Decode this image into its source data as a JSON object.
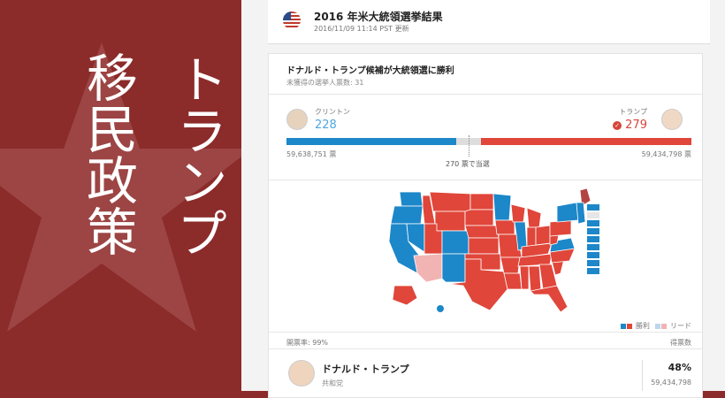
{
  "overlay": {
    "col1": "トランプ",
    "col2": "移民政策"
  },
  "header": {
    "title": "2016 年米大統領選挙結果",
    "updated": "2016/11/09 11:14 PST 更新"
  },
  "result": {
    "headline": "ドナルド・トランプ候補が大統領選に勝利",
    "uncounted": "未獲得の選挙人票数: 31",
    "left_name": "クリントン",
    "left_ev": "228",
    "right_name": "トランプ",
    "right_ev": "279",
    "left_votes": "59,638,751 票",
    "right_votes": "59,434,798 票",
    "threshold": "270 票で当選",
    "blue_fraction": 0.42,
    "red_fraction": 0.52
  },
  "map": {
    "legend_win": "勝利",
    "legend_lead": "リード",
    "colors": {
      "blue": "#1c87c9",
      "red": "#e0463a",
      "lead": "#f2b3b3"
    }
  },
  "table": {
    "counted": "開票率: 99%",
    "col_votes": "得票数",
    "row1_name": "ドナルド・トランプ",
    "row1_party": "共和党",
    "row1_pct": "48%",
    "row1_votes": "59,434,798"
  }
}
